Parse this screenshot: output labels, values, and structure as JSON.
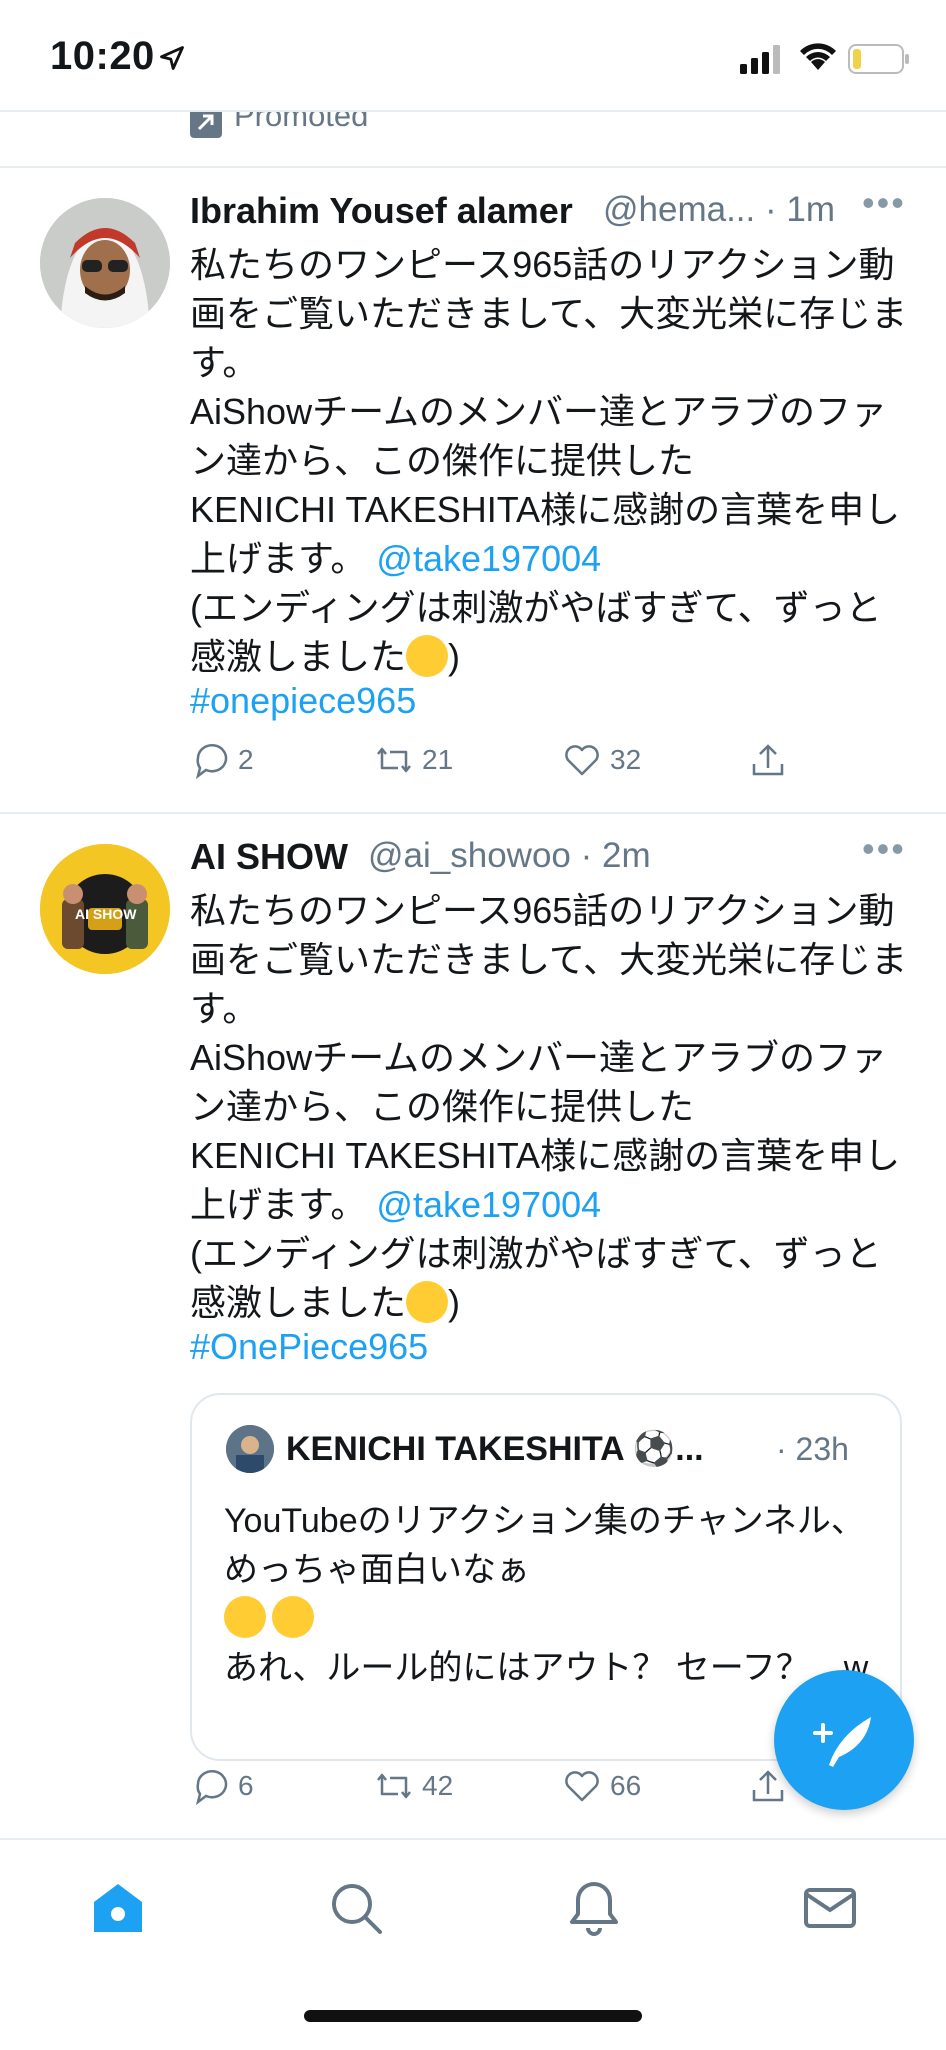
{
  "status_bar": {
    "time": "10:20"
  },
  "promoted": {
    "label": "Promoted"
  },
  "tweets": [
    {
      "name": "Ibrahim Yousef alamer",
      "handle_time": "@hema... · 1m",
      "body": "私たちのワンピース965話のリアクション動画をご覧いただきまして、大変光栄に存じます。\nAiShowチームのメンバー達とアラブのファン達から、この傑作に提供した\nKENICHI TAKESHITA様に感謝の言葉を申し上げます。",
      "mention": "@take197004",
      "body2": "(エンディングは刺激がやばすぎて、ずっと感激しました",
      "body2_end": ")",
      "hashtag": "#onepiece965",
      "replies": "2",
      "retweets": "21",
      "likes": "32"
    },
    {
      "name": "AI SHOW",
      "handle_time": "@ai_showoo · 2m",
      "body": "私たちのワンピース965話のリアクション動画をご覧いただきまして、大変光栄に存じます。\nAiShowチームのメンバー達とアラブのファン達から、この傑作に提供した\nKENICHI TAKESHITA様に感謝の言葉を申し上げます。",
      "mention": "@take197004",
      "body2": "(エンディングは刺激がやばすぎて、ずっと感激しました",
      "body2_end": ")",
      "hashtag": "#OnePiece965",
      "replies": "6",
      "retweets": "42",
      "likes": "66",
      "avatar_text": "AI SHOW"
    }
  ],
  "quote": {
    "name": "KENICHI TAKESHITA ⚽...",
    "time": "· 23h",
    "body1": "YouTubeのリアクション集のチャンネル、めっちゃ面白いなぁ",
    "body2": "あれ、ルール的にはアウト？ セーフ？　w"
  },
  "icons": {
    "reply": "reply-icon",
    "retweet": "retweet-icon",
    "like": "heart-icon",
    "share": "share-icon",
    "compose": "compose-icon",
    "home": "home-icon",
    "search": "search-icon",
    "notifications": "bell-icon",
    "messages": "mail-icon"
  },
  "colors": {
    "accent": "#1da1f2",
    "text": "#14171a",
    "muted": "#657786"
  }
}
